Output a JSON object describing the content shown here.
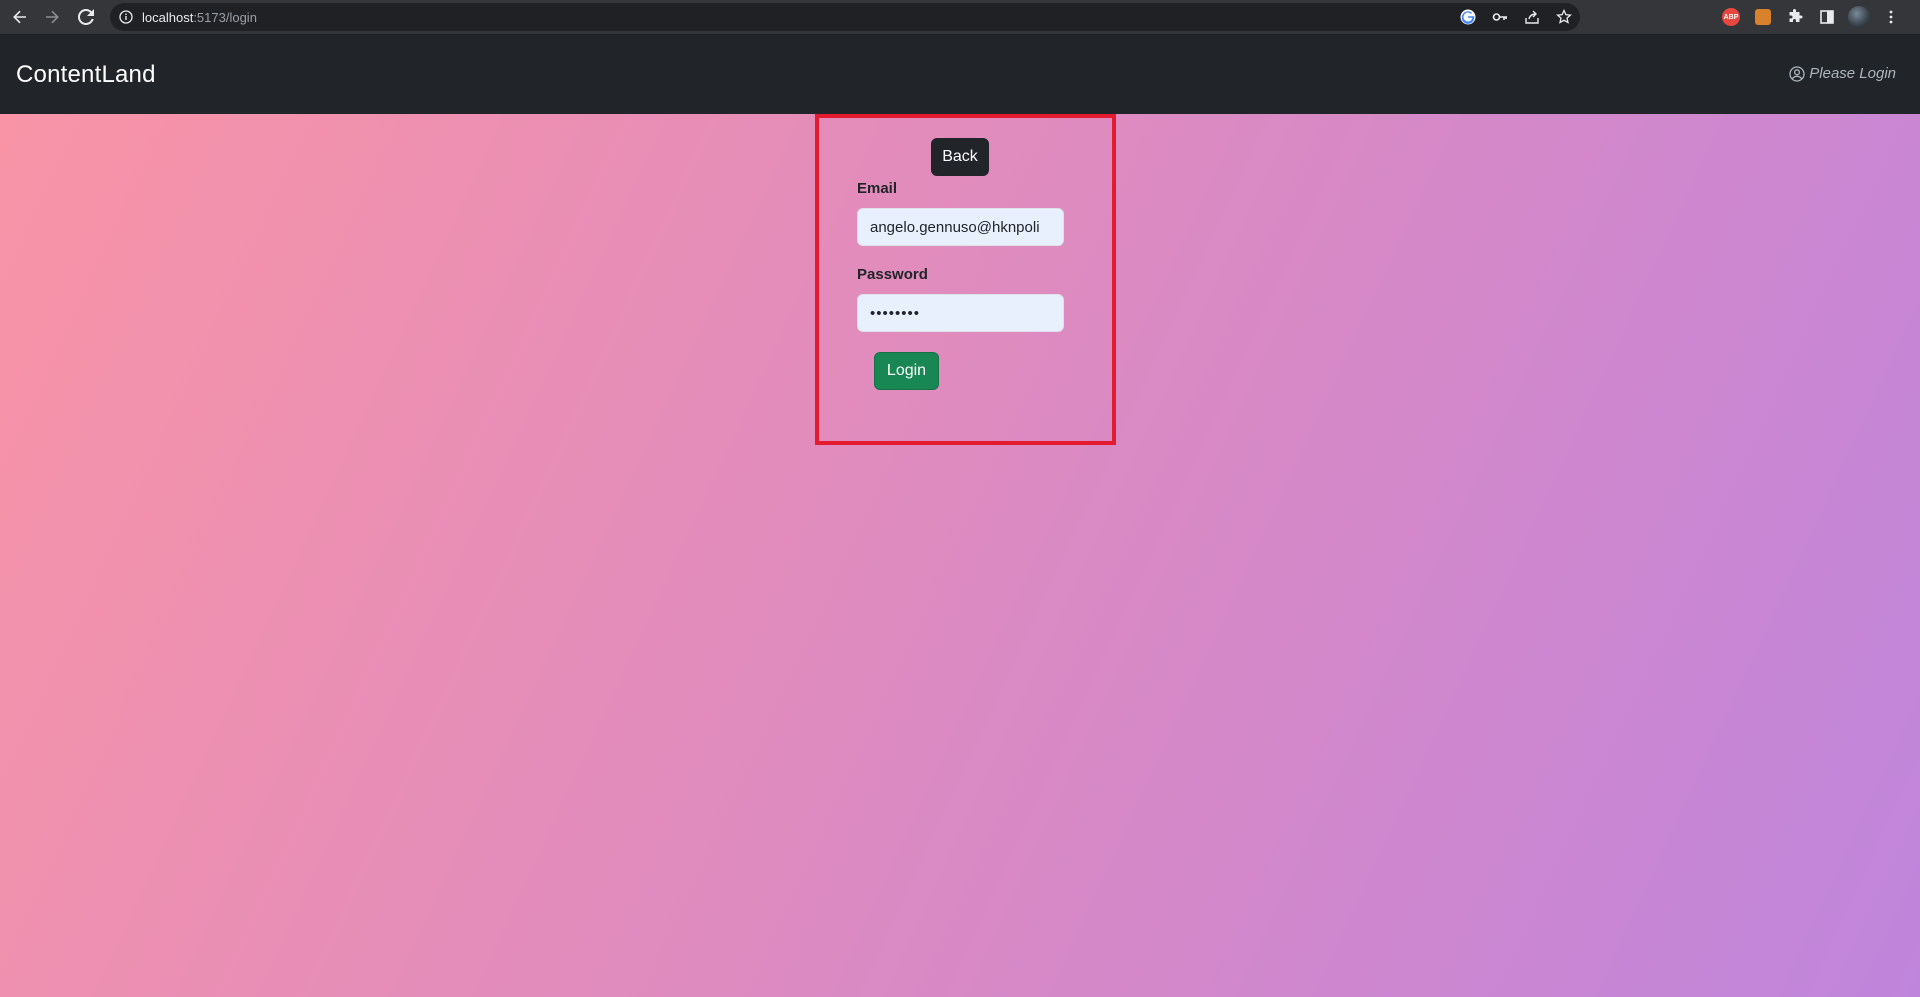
{
  "browser": {
    "url_host": "localhost",
    "url_path": ":5173/login",
    "icons": [
      "back-arrow-icon",
      "forward-arrow-icon",
      "reload-icon",
      "info-icon",
      "google-icon",
      "key-icon",
      "share-icon",
      "star-icon",
      "adblock-icon",
      "extension-orange-icon",
      "puzzle-icon",
      "sidebar-icon",
      "profile-avatar",
      "menu-dots-icon"
    ],
    "abp_label": "ABP"
  },
  "navbar": {
    "brand": "ContentLand",
    "login_hint": "Please Login"
  },
  "form": {
    "back_label": "Back",
    "email_label": "Email",
    "email_value": "angelo.gennuso@hknpoli",
    "password_label": "Password",
    "password_value": "••••••••",
    "login_label": "Login"
  },
  "colors": {
    "navbar_bg": "#212529",
    "highlight_border": "#e41a2e",
    "login_button": "#198754",
    "gradient_start": "#f994a6",
    "gradient_end": "#bf85dc"
  }
}
